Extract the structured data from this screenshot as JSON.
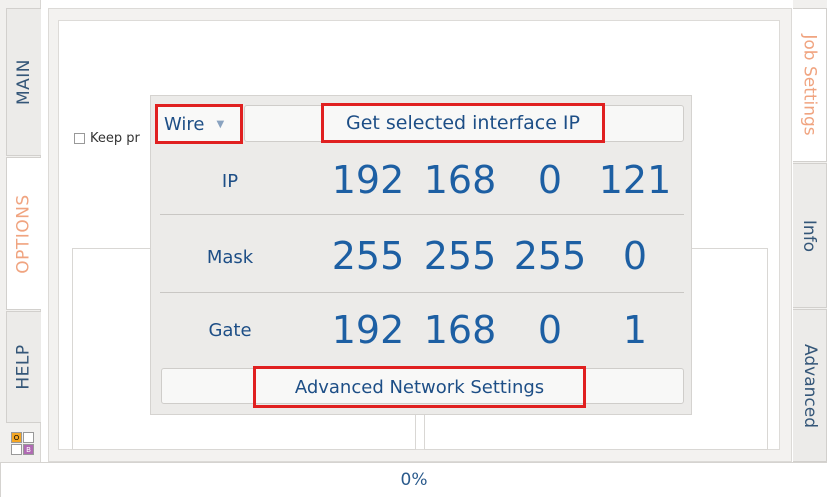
{
  "left_tabs": [
    {
      "label": "MAIN",
      "active": false
    },
    {
      "label": "OPTIONS",
      "active": true
    },
    {
      "label": "HELP",
      "active": false
    }
  ],
  "right_tabs": [
    {
      "label": "Job Settings",
      "active": true
    },
    {
      "label": "Info",
      "active": false
    },
    {
      "label": "Advanced",
      "active": false
    }
  ],
  "background": {
    "keep_checkbox_label": "Keep pr",
    "keep_checked": false
  },
  "network": {
    "interface_selected": "Wire",
    "get_ip_label": "Get selected interface IP",
    "rows": [
      {
        "label": "IP",
        "octets": [
          "192",
          "168",
          "0",
          "121"
        ]
      },
      {
        "label": "Mask",
        "octets": [
          "255",
          "255",
          "255",
          "0"
        ]
      },
      {
        "label": "Gate",
        "octets": [
          "192",
          "168",
          "0",
          "1"
        ]
      }
    ],
    "advanced_label": "Advanced Network Settings"
  },
  "mini_icons": [
    "O",
    "B"
  ],
  "progress": {
    "percent": 0,
    "label": "0%"
  },
  "colors": {
    "active_tab_text": "#f0a480",
    "tab_text": "#345678",
    "value_text": "#1d5fa3",
    "highlight": "#e02020"
  }
}
